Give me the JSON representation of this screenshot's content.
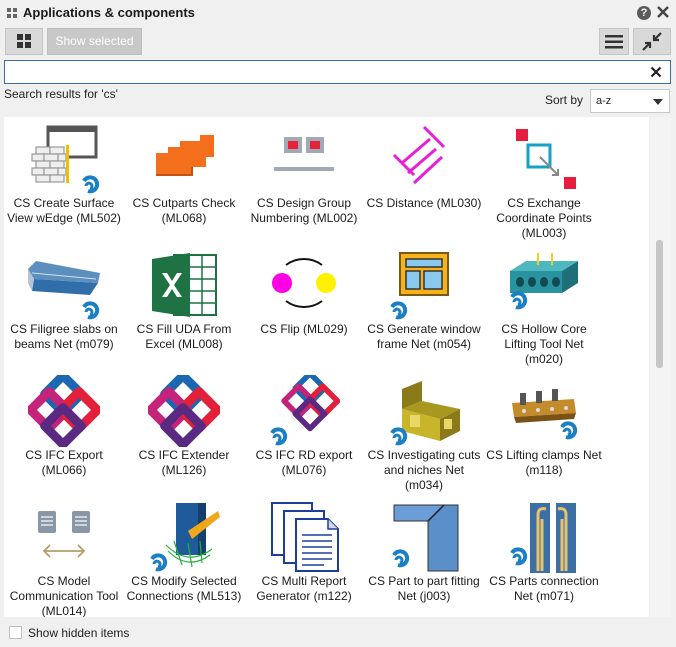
{
  "window": {
    "title": "Applications & components"
  },
  "toolbar": {
    "show_selected_label": "Show selected"
  },
  "search": {
    "value": "",
    "results_text": "Search results for 'cs'"
  },
  "sort": {
    "label": "Sort by",
    "value": "a-z"
  },
  "items": [
    {
      "line1": "CS Create Surface",
      "line2": "View wEdge (ML502)",
      "line3": ""
    },
    {
      "line1": "CS Cutparts Check",
      "line2": "(ML068)",
      "line3": ""
    },
    {
      "line1": "CS Design Group",
      "line2": "Numbering (ML002)",
      "line3": ""
    },
    {
      "line1": "CS Distance (ML030)",
      "line2": "",
      "line3": ""
    },
    {
      "line1": "CS Exchange",
      "line2": "Coordinate Points",
      "line3": "(ML003)"
    },
    {
      "line1": "CS Filigree slabs on",
      "line2": "beams Net (m079)",
      "line3": ""
    },
    {
      "line1": "CS Fill UDA From",
      "line2": "Excel (ML008)",
      "line3": ""
    },
    {
      "line1": "CS Flip (ML029)",
      "line2": "",
      "line3": ""
    },
    {
      "line1": "CS Generate window",
      "line2": "frame Net (m054)",
      "line3": ""
    },
    {
      "line1": "CS Hollow Core",
      "line2": "Lifting Tool Net",
      "line3": "(m020)"
    },
    {
      "line1": "CS IFC Export",
      "line2": "(ML066)",
      "line3": ""
    },
    {
      "line1": "CS IFC Extender",
      "line2": "(ML126)",
      "line3": ""
    },
    {
      "line1": "CS IFC RD export",
      "line2": "(ML076)",
      "line3": ""
    },
    {
      "line1": "CS Investigating cuts",
      "line2": "and niches Net",
      "line3": "(m034)"
    },
    {
      "line1": "CS Lifting clamps Net",
      "line2": "(m118)",
      "line3": ""
    },
    {
      "line1": "CS Model",
      "line2": "Communication Tool",
      "line3": "(ML014)"
    },
    {
      "line1": "CS Modify Selected",
      "line2": "Connections (ML513)",
      "line3": ""
    },
    {
      "line1": "CS Multi Report",
      "line2": "Generator (m122)",
      "line3": ""
    },
    {
      "line1": "CS Part to part fitting",
      "line2": "Net (j003)",
      "line3": ""
    },
    {
      "line1": "CS Parts connection",
      "line2": "Net (m071)",
      "line3": ""
    }
  ],
  "footer": {
    "show_hidden_label": "Show hidden items"
  },
  "colors": {
    "accent": "#1a7fc4",
    "pink": "#e62190",
    "excel": "#1f7244"
  }
}
